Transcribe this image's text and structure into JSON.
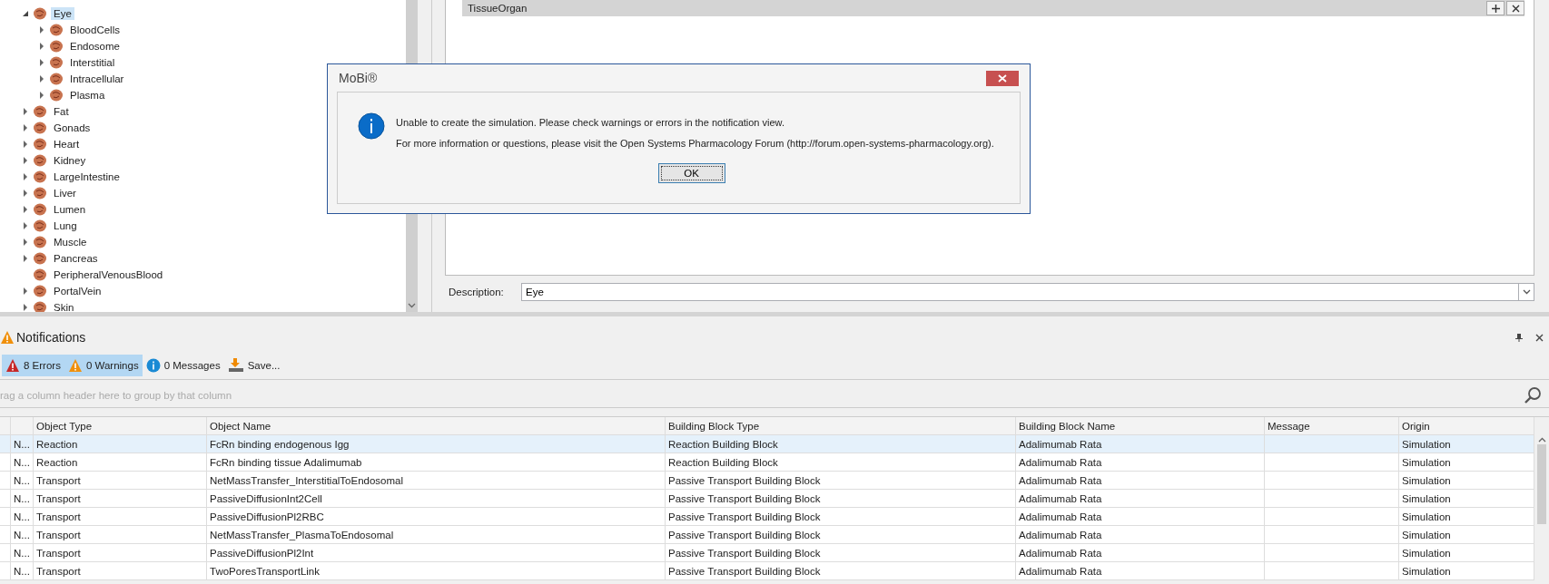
{
  "tree": {
    "items": [
      {
        "label": "Eye",
        "selected": true,
        "expanded": true,
        "children": [
          {
            "label": "BloodCells",
            "selected": false,
            "expanded": false
          },
          {
            "label": "Endosome",
            "selected": false,
            "expanded": false
          },
          {
            "label": "Interstitial",
            "selected": false,
            "expanded": false
          },
          {
            "label": "Intracellular",
            "selected": false,
            "expanded": false
          },
          {
            "label": "Plasma",
            "selected": false,
            "expanded": false
          }
        ]
      },
      {
        "label": "Fat",
        "selected": false,
        "expanded": false
      },
      {
        "label": "Gonads",
        "selected": false,
        "expanded": false
      },
      {
        "label": "Heart",
        "selected": false,
        "expanded": false
      },
      {
        "label": "Kidney",
        "selected": false,
        "expanded": false
      },
      {
        "label": "LargeIntestine",
        "selected": false,
        "expanded": false
      },
      {
        "label": "Liver",
        "selected": false,
        "expanded": false
      },
      {
        "label": "Lumen",
        "selected": false,
        "expanded": false
      },
      {
        "label": "Lung",
        "selected": false,
        "expanded": false
      },
      {
        "label": "Muscle",
        "selected": false,
        "expanded": false
      },
      {
        "label": "Pancreas",
        "selected": false,
        "expanded": false
      },
      {
        "label": "PeripheralVenousBlood",
        "selected": false
      },
      {
        "label": "PortalVein",
        "selected": false,
        "expanded": false
      },
      {
        "label": "Skin",
        "selected": false,
        "expanded": false
      }
    ]
  },
  "editor": {
    "tag_bar": {
      "label": "TissueOrgan"
    },
    "description": {
      "label": "Description:",
      "value": "Eye"
    }
  },
  "dialog": {
    "title": "MoBi®",
    "lines": [
      "Unable to create the simulation. Please check warnings or errors in the notification view.",
      "For more information or questions, please visit the Open Systems Pharmacology Forum (http://forum.open-systems-pharmacology.org)."
    ],
    "button": "OK"
  },
  "notifications": {
    "title": "Notifications",
    "filters": [
      {
        "kind": "error",
        "label": "8 Errors",
        "selected": true
      },
      {
        "kind": "warning",
        "label": "0 Warnings",
        "selected": true
      },
      {
        "kind": "info",
        "label": "0 Messages",
        "selected": false
      }
    ],
    "save": "Save...",
    "group_panel": "rag a column header here to group by that column",
    "table": {
      "columns": [
        "Object Type",
        "Object Name",
        "Building Block Type",
        "Building Block Name",
        "Message",
        "Origin"
      ],
      "rows": [
        {
          "selected": true,
          "column_2": "N...",
          "object_type": "Reaction",
          "object_name": "FcRn binding endogenous Igg",
          "building_block_type": "Reaction Building Block",
          "building_block_name": "Adalimumab Rata",
          "origin": "Simulation"
        },
        {
          "selected": false,
          "column_2": "N...",
          "object_type": "Reaction",
          "object_name": "FcRn binding tissue Adalimumab",
          "building_block_type": "Reaction Building Block",
          "building_block_name": "Adalimumab Rata",
          "origin": "Simulation"
        },
        {
          "selected": false,
          "column_2": "N...",
          "object_type": "Transport",
          "object_name": "NetMassTransfer_InterstitialToEndosomal",
          "building_block_type": "Passive Transport Building Block",
          "building_block_name": "Adalimumab Rata",
          "origin": "Simulation"
        },
        {
          "selected": false,
          "column_2": "N...",
          "object_type": "Transport",
          "object_name": "PassiveDiffusionInt2Cell",
          "building_block_type": "Passive Transport Building Block",
          "building_block_name": "Adalimumab Rata",
          "origin": "Simulation"
        },
        {
          "selected": false,
          "column_2": "N...",
          "object_type": "Transport",
          "object_name": "PassiveDiffusionPl2RBC",
          "building_block_type": "Passive Transport Building Block",
          "building_block_name": "Adalimumab Rata",
          "origin": "Simulation"
        },
        {
          "selected": false,
          "column_2": "N...",
          "object_type": "Transport",
          "object_name": "NetMassTransfer_PlasmaToEndosomal",
          "building_block_type": "Passive Transport Building Block",
          "building_block_name": "Adalimumab Rata",
          "origin": "Simulation"
        },
        {
          "selected": false,
          "column_2": "N...",
          "object_type": "Transport",
          "object_name": "PassiveDiffusionPl2Int",
          "building_block_type": "Passive Transport Building Block",
          "building_block_name": "Adalimumab Rata",
          "origin": "Simulation"
        },
        {
          "selected": false,
          "column_2": "N...",
          "object_type": "Transport",
          "object_name": "TwoPoresTransportLink",
          "building_block_type": "Passive Transport Building Block",
          "building_block_name": "Adalimumab Rata",
          "origin": "Simulation"
        }
      ]
    }
  }
}
